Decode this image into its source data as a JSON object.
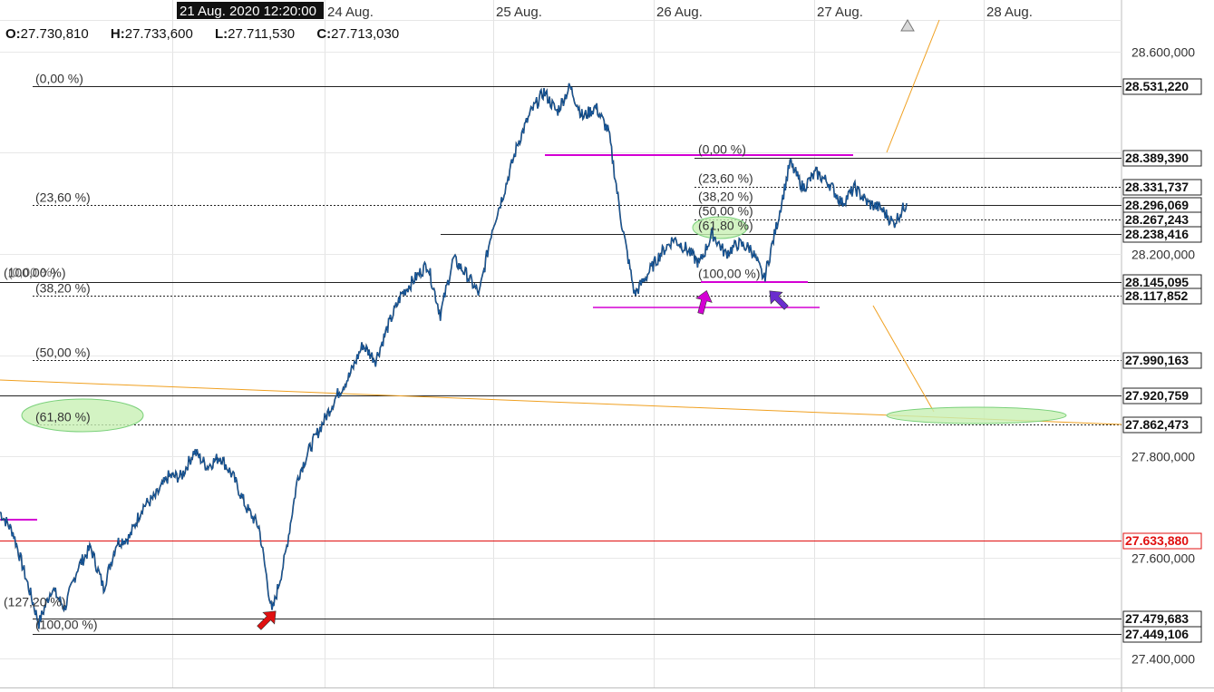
{
  "header": {
    "timestamp": "21 Aug. 2020 12:20:00",
    "ohlc": [
      {
        "key": "O:",
        "value": "27.730,810"
      },
      {
        "key": "H:",
        "value": "27.733,600"
      },
      {
        "key": "L:",
        "value": "27.711,530"
      },
      {
        "key": "C:",
        "value": "27.713,030"
      }
    ]
  },
  "chart_data": {
    "type": "line",
    "x_labels": [
      "24 Aug.",
      "25 Aug.",
      "26 Aug.",
      "27 Aug.",
      "28 Aug."
    ],
    "y_ticks": [
      "28.600,000",
      "28.200,000",
      "27.800,000",
      "27.600,000",
      "27.400,000"
    ],
    "ylim": [
      27380,
      28680
    ],
    "grid": true,
    "series_color": "#1a5fa8",
    "price_series": [
      27690,
      27650,
      27560,
      27470,
      27540,
      27500,
      27580,
      27620,
      27540,
      27630,
      27640,
      27700,
      27720,
      27760,
      27760,
      27810,
      27780,
      27800,
      27760,
      27700,
      27660,
      27490,
      27600,
      27760,
      27820,
      27870,
      27920,
      27960,
      28020,
      27990,
      28060,
      28120,
      28150,
      28180,
      28080,
      28190,
      28160,
      28120,
      28250,
      28330,
      28420,
      28480,
      28520,
      28480,
      28530,
      28470,
      28490,
      28440,
      28260,
      28120,
      28160,
      28200,
      28230,
      28210,
      28180,
      28240,
      28200,
      28220,
      28210,
      28150,
      28260,
      28380,
      28330,
      28360,
      28340,
      28300,
      28330,
      28300,
      28290,
      28260,
      28300
    ],
    "price_labels": [
      {
        "text": "28.531,220",
        "value": 28531.22,
        "style": "box"
      },
      {
        "text": "28.389,390",
        "value": 28389.39,
        "style": "box"
      },
      {
        "text": "28.331,737",
        "value": 28331.737,
        "style": "box"
      },
      {
        "text": "28.296,069",
        "value": 28296.069,
        "style": "box"
      },
      {
        "text": "28.267,243",
        "value": 28267.243,
        "style": "box"
      },
      {
        "text": "28.238,416",
        "value": 28238.416,
        "style": "box"
      },
      {
        "text": "28.145,095",
        "value": 28145.095,
        "style": "box"
      },
      {
        "text": "28.117,852",
        "value": 28117.852,
        "style": "box"
      },
      {
        "text": "27.990,163",
        "value": 27990.163,
        "style": "box"
      },
      {
        "text": "27.920,759",
        "value": 27920.759,
        "style": "box"
      },
      {
        "text": "27.862,473",
        "value": 27862.473,
        "style": "box"
      },
      {
        "text": "27.633,880",
        "value": 27633.88,
        "style": "red"
      },
      {
        "text": "27.479,683",
        "value": 27479.683,
        "style": "box"
      },
      {
        "text": "27.449,106",
        "value": 27449.106,
        "style": "box"
      }
    ],
    "fib_large": [
      {
        "text": "(0,00 %)",
        "value": 28531.22,
        "line": "solid"
      },
      {
        "text": "(23,60 %)",
        "value": 28296.069,
        "line": "dotted"
      },
      {
        "text": "(38,20 %)",
        "value": 28117.852,
        "line": "dotted"
      },
      {
        "text": "(50,00 %)",
        "value": 27990.163,
        "line": "dotted"
      },
      {
        "text": "(61,80 %)",
        "value": 27862.473,
        "line": "dotted"
      },
      {
        "text": "(100,00 %)",
        "value": 27449.106,
        "line": "solid"
      },
      {
        "text": "(127,20 %)",
        "value": 27479.683,
        "line": "solid"
      },
      {
        "text": "(100,00 %)",
        "value": 28145.095,
        "line": "solid"
      }
    ],
    "fib_small": [
      {
        "text": "(0,00 %)",
        "value": 28389.39
      },
      {
        "text": "(23,60 %)",
        "value": 28331.737
      },
      {
        "text": "(38,20 %)",
        "value": 28296.069
      },
      {
        "text": "(50,00 %)",
        "value": 28267.243
      },
      {
        "text": "(61,80 %)",
        "value": 28238.416
      },
      {
        "text": "(100,00 %)",
        "value": 28145.095
      }
    ],
    "extra_hlines": [
      27920.759
    ],
    "annotation_colors": {
      "magenta": "#d400d4",
      "orange": "#f0a020",
      "green_fill": "#c8f0b4",
      "green_stroke": "#7ad07a",
      "red_arrow": "#e01010",
      "purple_arrow": "#6a2ccf",
      "red_line": "#e01010"
    }
  }
}
